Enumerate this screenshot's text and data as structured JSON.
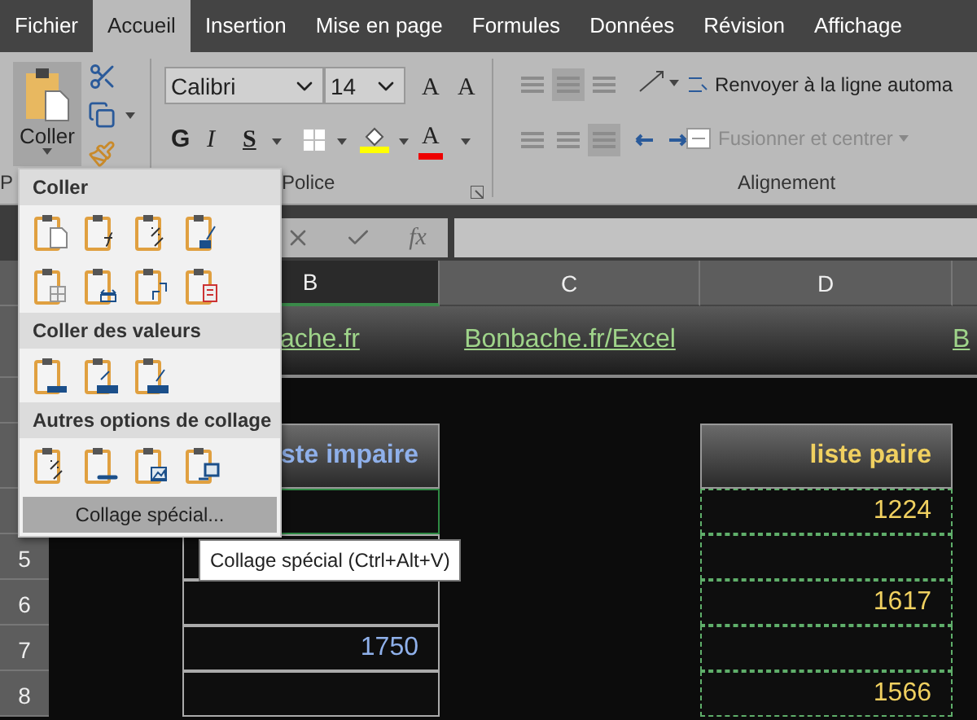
{
  "tabs": [
    {
      "label": "Fichier",
      "selected": false
    },
    {
      "label": "Accueil",
      "selected": true
    },
    {
      "label": "Insertion",
      "selected": false
    },
    {
      "label": "Mise en page",
      "selected": false
    },
    {
      "label": "Formules",
      "selected": false
    },
    {
      "label": "Données",
      "selected": false
    },
    {
      "label": "Révision",
      "selected": false
    },
    {
      "label": "Affichage",
      "selected": false
    }
  ],
  "ribbon": {
    "clipboard": {
      "paste": "Coller",
      "group_label": "P"
    },
    "font": {
      "font_name": "Calibri",
      "font_size": "14",
      "grow": "A",
      "shrink": "A",
      "bold": "G",
      "italic": "I",
      "underline": "S",
      "font_color": "A",
      "group_label": "Police"
    },
    "alignment": {
      "wrap_text": "Renvoyer à la ligne automa",
      "merge": {
        "label": "Fusionner et centrer",
        "disabled": true
      },
      "group_label": "Alignement"
    }
  },
  "formula_bar": {
    "function": "fx"
  },
  "columns": [
    {
      "label": "B",
      "selected": true
    },
    {
      "label": "C",
      "selected": false
    },
    {
      "label": "D",
      "selected": false
    }
  ],
  "sheet": {
    "links": [
      "ache.fr",
      "Bonbache.fr/Excel",
      "B"
    ],
    "headers": [
      "ste impaire",
      "liste paire"
    ],
    "rows": [
      {
        "odd_selected": true,
        "even": "1224"
      },
      {
        "number": "5"
      },
      {
        "number": "6",
        "even": "1617"
      },
      {
        "number": "7",
        "odd": "1750"
      },
      {
        "number": "8",
        "even": "1566"
      }
    ]
  },
  "paste_menu": {
    "sections": [
      {
        "title": "Coller"
      },
      {
        "title": "Coller des valeurs"
      },
      {
        "title": "Autres options de collage"
      }
    ],
    "special": "Collage spécial..."
  },
  "tooltip": "Collage spécial (Ctrl+Alt+V)"
}
